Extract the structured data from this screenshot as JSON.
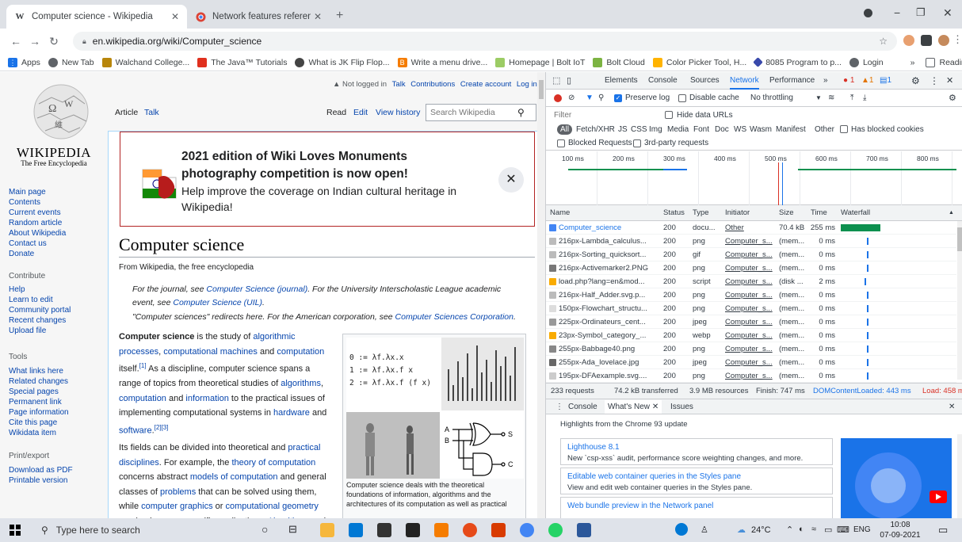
{
  "tabs": [
    {
      "title": "Computer science - Wikipedia",
      "favicon": "W"
    },
    {
      "title": "Network features reference - Chr",
      "favicon": "chrome"
    }
  ],
  "address": "en.wikipedia.org/wiki/Computer_science",
  "bookmarks": [
    "Apps",
    "New Tab",
    "Walchand College...",
    "The Java™ Tutorials",
    "What is JK Flip Flop...",
    "Write a menu drive...",
    "Homepage | Bolt IoT",
    "Bolt Cloud",
    "Color Picker Tool, H...",
    "8085 Program to p...",
    "Login"
  ],
  "reading_list": "Reading list",
  "wiki": {
    "logo_title": "WIKIPEDIA",
    "logo_sub": "The Free Encyclopedia",
    "user_links": [
      "Not logged in",
      "Talk",
      "Contributions",
      "Create account",
      "Log in"
    ],
    "tabs": {
      "article": "Article",
      "talk": "Talk",
      "read": "Read",
      "edit": "Edit",
      "history": "View history"
    },
    "search_placeholder": "Search Wikipedia",
    "nav": [
      "Main page",
      "Contents",
      "Current events",
      "Random article",
      "About Wikipedia",
      "Contact us",
      "Donate"
    ],
    "contribute_head": "Contribute",
    "contribute": [
      "Help",
      "Learn to edit",
      "Community portal",
      "Recent changes",
      "Upload file"
    ],
    "tools_head": "Tools",
    "tools": [
      "What links here",
      "Related changes",
      "Special pages",
      "Permanent link",
      "Page information",
      "Cite this page",
      "Wikidata item"
    ],
    "print_head": "Print/export",
    "print": [
      "Download as PDF",
      "Printable version"
    ],
    "banner": {
      "title1": "2021 edition of Wiki Loves Monuments",
      "title2": "photography competition is now open!",
      "body1": "Help improve the coverage on Indian cultural heritage in",
      "body2": "Wikipedia!"
    },
    "title": "Computer science",
    "subtitle": "From Wikipedia, the free encyclopedia",
    "hatnote1a": "For the journal, see ",
    "hatnote1b": "Computer Science (journal)",
    "hatnote1c": ". For the University Interscholastic League academic",
    "hatnote1d": "event, see ",
    "hatnote1e": "Computer Science (UIL)",
    "hatnote1f": ".",
    "hatnote2a": "\"Computer sciences\" redirects here. For the American corporation, see ",
    "hatnote2b": "Computer Sciences Corporation",
    "hatnote2c": ".",
    "para1": [
      [
        "b",
        "Computer science"
      ],
      [
        "t",
        " is the study of "
      ],
      [
        "a",
        "algorithmic"
      ]
    ],
    "p1l2": [
      [
        "a",
        "processes"
      ],
      [
        "t",
        ", "
      ],
      [
        "a",
        "computational machines"
      ],
      [
        "t",
        " and "
      ],
      [
        "a",
        "computation"
      ]
    ],
    "p1l3": [
      [
        "t",
        "itself."
      ],
      [
        "s",
        "[1]"
      ],
      [
        "t",
        " As a discipline, computer science spans a"
      ]
    ],
    "p1l4": [
      [
        "t",
        "range of topics from theoretical studies of "
      ],
      [
        "a",
        "algorithms"
      ],
      [
        "t",
        ","
      ]
    ],
    "p1l5": [
      [
        "a",
        "computation"
      ],
      [
        "t",
        " and "
      ],
      [
        "a",
        "information"
      ],
      [
        "t",
        " to the practical issues of"
      ]
    ],
    "p1l6": [
      [
        "t",
        "implementing computational systems in "
      ],
      [
        "a",
        "hardware"
      ],
      [
        "t",
        " and"
      ]
    ],
    "p1l7": [
      [
        "a",
        "software"
      ],
      [
        "t",
        "."
      ],
      [
        "s",
        "[2][3]"
      ]
    ],
    "p2l1": [
      [
        "t",
        "Its fields can be divided into theoretical and "
      ],
      [
        "a",
        "practical"
      ]
    ],
    "p2l2": [
      [
        "a",
        "disciplines"
      ],
      [
        "t",
        ". For example, the "
      ],
      [
        "a",
        "theory of computation"
      ]
    ],
    "p2l3": [
      [
        "t",
        "concerns abstract "
      ],
      [
        "a",
        "models of computation"
      ],
      [
        "t",
        " and general"
      ]
    ],
    "p2l4": [
      [
        "t",
        "classes of "
      ],
      [
        "a",
        "problems"
      ],
      [
        "t",
        " that can be solved using them,"
      ]
    ],
    "p2l5": [
      [
        "t",
        "while "
      ],
      [
        "a",
        "computer graphics"
      ],
      [
        "t",
        " or "
      ],
      [
        "a",
        "computational geometry"
      ]
    ],
    "p2l6": [
      [
        "t",
        "emphasize more specific applications. "
      ],
      [
        "a",
        "Algorithms"
      ],
      [
        "t",
        " and"
      ]
    ],
    "lambda": [
      "0 := λf.λx.x",
      "1 := λf.λx.f x",
      "2 := λf.λx.f (f x)"
    ],
    "gate_labels": [
      "A",
      "B",
      "S",
      "C"
    ],
    "caption": [
      "Computer science deals with the theoretical",
      "foundations of information, algorithms and the",
      "architectures of its computation as well as practical"
    ]
  },
  "devtools": {
    "tabs": [
      "Elements",
      "Console",
      "Sources",
      "Network",
      "Performance",
      "»"
    ],
    "badges": {
      "errors": "1",
      "warnings": "1",
      "info": "1"
    },
    "preserve_log": "Preserve log",
    "disable_cache": "Disable cache",
    "throttle": "No throttling",
    "filter_placeholder": "Filter",
    "hide_data_urls": "Hide data URLs",
    "types": [
      "All",
      "Fetch/XHR",
      "JS",
      "CSS",
      "Img",
      "Media",
      "Font",
      "Doc",
      "WS",
      "Wasm",
      "Manifest",
      "Other"
    ],
    "has_blocked_cookies": "Has blocked cookies",
    "blocked_requests": "Blocked Requests",
    "third_party": "3rd-party requests",
    "timeline_ticks": [
      "100 ms",
      "200 ms",
      "300 ms",
      "400 ms",
      "500 ms",
      "600 ms",
      "700 ms",
      "800 ms"
    ],
    "columns": [
      "Name",
      "Status",
      "Type",
      "Initiator",
      "Size",
      "Time",
      "Waterfall"
    ],
    "rows": [
      {
        "name": "Computer_science",
        "status": "200",
        "type": "docu...",
        "initiator": "Other",
        "size": "70.4 kB",
        "time": "255 ms"
      },
      {
        "name": "216px-Lambda_calculus...",
        "status": "200",
        "type": "png",
        "initiator": "Computer_s...",
        "size": "(mem...",
        "time": "0 ms"
      },
      {
        "name": "216px-Sorting_quicksort...",
        "status": "200",
        "type": "gif",
        "initiator": "Computer_s...",
        "size": "(mem...",
        "time": "0 ms"
      },
      {
        "name": "216px-Activemarker2.PNG",
        "status": "200",
        "type": "png",
        "initiator": "Computer_s...",
        "size": "(mem...",
        "time": "0 ms"
      },
      {
        "name": "load.php?lang=en&mod...",
        "status": "200",
        "type": "script",
        "initiator": "Computer_s...",
        "size": "(disk ...",
        "time": "2 ms"
      },
      {
        "name": "216px-Half_Adder.svg.p...",
        "status": "200",
        "type": "png",
        "initiator": "Computer_s...",
        "size": "(mem...",
        "time": "0 ms"
      },
      {
        "name": "150px-Flowchart_structu...",
        "status": "200",
        "type": "png",
        "initiator": "Computer_s...",
        "size": "(mem...",
        "time": "0 ms"
      },
      {
        "name": "225px-Ordinateurs_cent...",
        "status": "200",
        "type": "jpeg",
        "initiator": "Computer_s...",
        "size": "(mem...",
        "time": "0 ms"
      },
      {
        "name": "23px-Symbol_category_...",
        "status": "200",
        "type": "webp",
        "initiator": "Computer_s...",
        "size": "(mem...",
        "time": "0 ms"
      },
      {
        "name": "255px-Babbage40.png",
        "status": "200",
        "type": "png",
        "initiator": "Computer_s...",
        "size": "(mem...",
        "time": "0 ms"
      },
      {
        "name": "255px-Ada_lovelace.jpg",
        "status": "200",
        "type": "jpeg",
        "initiator": "Computer_s...",
        "size": "(mem...",
        "time": "0 ms"
      },
      {
        "name": "195px-DFAexample.svg....",
        "status": "200",
        "type": "png",
        "initiator": "Computer_s...",
        "size": "(mem...",
        "time": "0 ms"
      }
    ],
    "summary": {
      "requests": "233 requests",
      "transferred": "74.2 kB transferred",
      "resources": "3.9 MB resources",
      "finish": "Finish: 747 ms",
      "dcl": "DOMContentLoaded: 443 ms",
      "load": "Load: 458 m"
    },
    "drawer_tabs": [
      "Console",
      "What's New",
      "Issues"
    ],
    "whatsnew_head": "Highlights from the Chrome 93 update",
    "cards": [
      {
        "title": "Lighthouse 8.1",
        "desc": "New `csp-xss` audit, performance score weighting changes, and more."
      },
      {
        "title": "Editable web container queries in the Styles pane",
        "desc": "View and edit web container queries in the Styles pane."
      },
      {
        "title": "Web bundle preview in the Network panel",
        "desc": ""
      }
    ]
  },
  "taskbar": {
    "search": "Type here to search",
    "temp": "24°C",
    "lang": "ENG",
    "time": "10:08",
    "date": "07-09-2021"
  }
}
